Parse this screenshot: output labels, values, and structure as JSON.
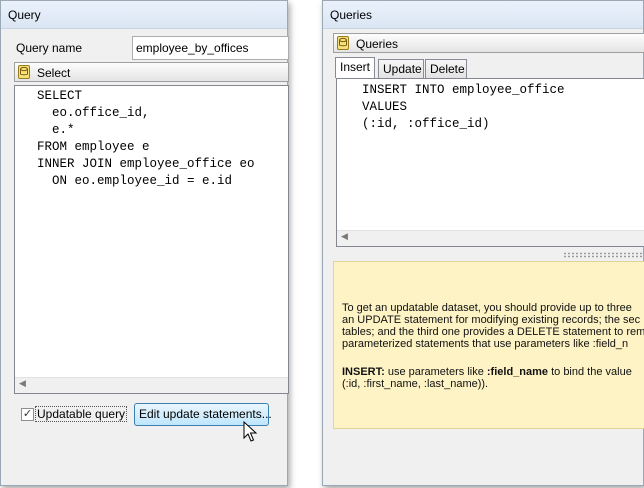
{
  "left_window": {
    "title": "Query",
    "query_name_label": "Query name",
    "query_name_value": "employee_by_offices",
    "section_label": "Select",
    "sql_lines": [
      "SELECT",
      "  eo.office_id,",
      "  e.*",
      "FROM employee e",
      "INNER JOIN employee_office eo",
      "  ON eo.employee_id = e.id"
    ],
    "updatable_checkbox_label": "Updatable query",
    "updatable_checked": true,
    "edit_button_label": "Edit update statements..."
  },
  "right_window": {
    "title": "Queries",
    "section_label": "Queries",
    "tabs": [
      {
        "label": "Insert",
        "active": true
      },
      {
        "label": "Update",
        "active": false
      },
      {
        "label": "Delete",
        "active": false
      }
    ],
    "sql_lines": [
      "INSERT INTO employee_office",
      "VALUES",
      "(:id, :office_id)"
    ],
    "info_lines": [
      "To get an updatable dataset, you should provide up to three",
      "an UPDATE statement for modifying existing records; the sec",
      "tables; and the third one provides a DELETE statement to rem",
      "parameterized statements that use parameters like :field_n"
    ],
    "info_insert_label": "INSERT:",
    "info_insert_text": " use parameters like ",
    "info_insert_param": ":field_name",
    "info_insert_rest": " to bind the value",
    "info_insert_line2": "(:id, :first_name, :last_name))."
  },
  "colors": {
    "title_bar": "#dbe6f4",
    "info_background": "#fdf3c5",
    "button_border": "#3c7fb1"
  }
}
